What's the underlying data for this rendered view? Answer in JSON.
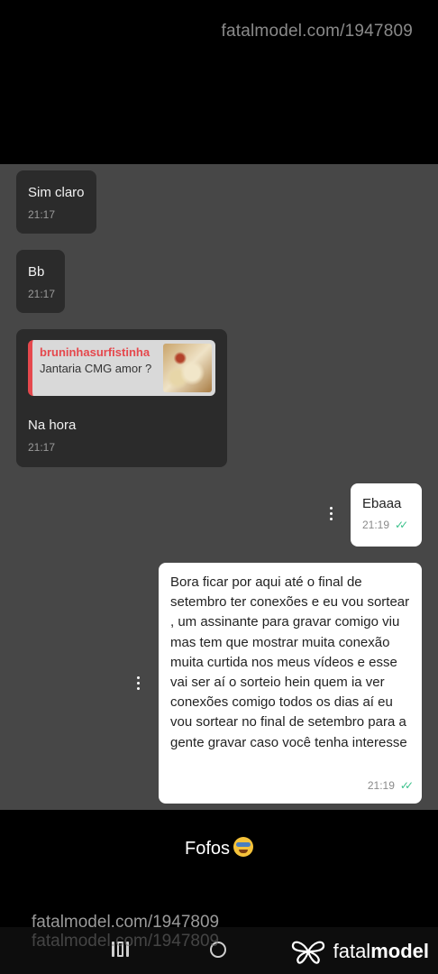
{
  "watermark": {
    "top": "fatalmodel.com/1947809",
    "bottom": "fatalmodel.com/1947809",
    "bottom_ghost": "fatalmodel.com/1947809"
  },
  "messages": [
    {
      "direction": "incoming",
      "text": "Sim claro",
      "time": "21:17"
    },
    {
      "direction": "incoming",
      "text": "Bb",
      "time": "21:17"
    },
    {
      "direction": "incoming",
      "reply": {
        "author": "bruninhasurfistinha",
        "text": "Jantaria CMG amor ?"
      },
      "text": "Na hora",
      "time": "21:17"
    },
    {
      "direction": "outgoing",
      "text": "Ebaaa",
      "time": "21:19",
      "status": "read"
    },
    {
      "direction": "outgoing",
      "text": "Bora ficar por aqui até o final de setembro ter conexões e eu vou sortear , um assinante para gravar comigo viu mas tem que mostrar muita conexão muita curtida nos meus vídeos e esse vai ser aí o sorteio hein quem ia ver conexões comigo todos os dias aí eu vou sortear no final de setembro para a gente gravar caso você tenha interesse",
      "time": "21:19",
      "status": "read"
    }
  ],
  "caption": "Fofos",
  "brand": {
    "name_light": "fatal",
    "name_bold": "model"
  },
  "colors": {
    "read_tick": "#3cc18c",
    "reply_accent": "#e5484d"
  }
}
